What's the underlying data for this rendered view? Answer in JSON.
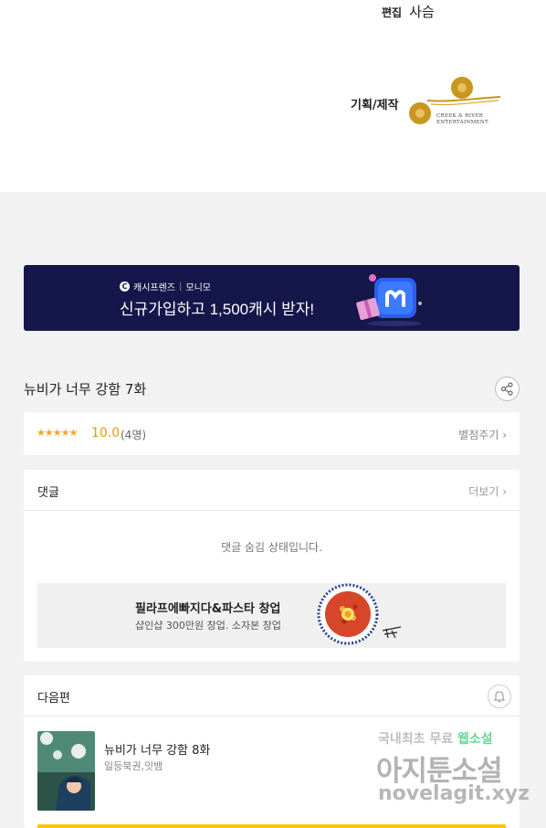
{
  "credits": {
    "edit_label": "편집",
    "edit_value": "사슴",
    "production_label": "기획/제작",
    "logo_text_line1": "CREEK & RIVER",
    "logo_text_line2": "ENTERTAINMENT"
  },
  "banner": {
    "brand_icon": "C",
    "brand_name": "캐시프렌즈",
    "brand_separator": "|",
    "brand_partner": "모니모",
    "headline": "신규가입하고 1,500캐시 받자!"
  },
  "episode": {
    "title": "뉴비가 너무 강함 7화",
    "share_icon": "share-icon"
  },
  "rating": {
    "stars": "★★★★★",
    "score": "10.0",
    "count": "(4명)",
    "rate_link": "별점주기 ›",
    "star_color": "#f5a623"
  },
  "comments": {
    "header": "댓글",
    "more": "더보기 ›",
    "hidden_message": "댓글 숨김 상태입니다.",
    "ad_title": "필라프에빠지다&파스타 창업",
    "ad_subtitle": "샵인샵 300만원 창업. 소자본 창업"
  },
  "next_episode": {
    "header": "다음편",
    "title": "뉴비가 너무 강함 8화",
    "author": "일등북권,잇뱀",
    "accent_color": "#f7c600"
  },
  "watermark": {
    "line1_a": "국내최초 무료 ",
    "line1_b": "웹소설",
    "line2": "아지툰소설",
    "line3": "novelagit.xyz"
  }
}
